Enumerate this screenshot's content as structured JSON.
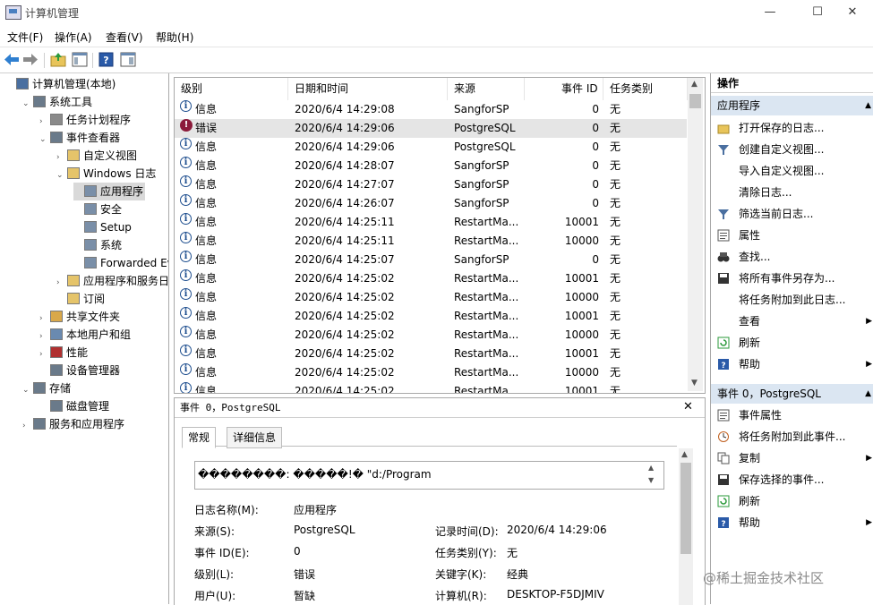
{
  "window": {
    "title": "计算机管理",
    "minimize": "—",
    "maximize": "☐",
    "close": "✕"
  },
  "menu": [
    "文件(F)",
    "操作(A)",
    "查看(V)",
    "帮助(H)"
  ],
  "tree": [
    {
      "label": "计算机管理(本地)",
      "indent": 0,
      "exp": "",
      "color": "#4a6fa0"
    },
    {
      "label": "系统工具",
      "indent": 1,
      "exp": "⌄",
      "color": "#6a7a8a"
    },
    {
      "label": "任务计划程序",
      "indent": 2,
      "exp": "›",
      "color": "#8a8a8a"
    },
    {
      "label": "事件查看器",
      "indent": 2,
      "exp": "⌄",
      "color": "#6a7a8a"
    },
    {
      "label": "自定义视图",
      "indent": 3,
      "exp": "›",
      "color": "#e5c46a"
    },
    {
      "label": "Windows 日志",
      "indent": 3,
      "exp": "⌄",
      "color": "#e5c46a"
    },
    {
      "label": "应用程序",
      "indent": 4,
      "exp": "",
      "color": "#7a8fa8",
      "selected": true
    },
    {
      "label": "安全",
      "indent": 4,
      "exp": "",
      "color": "#7a8fa8"
    },
    {
      "label": "Setup",
      "indent": 4,
      "exp": "",
      "color": "#7a8fa8"
    },
    {
      "label": "系统",
      "indent": 4,
      "exp": "",
      "color": "#7a8fa8"
    },
    {
      "label": "Forwarded Eve",
      "indent": 4,
      "exp": "",
      "color": "#7a8fa8"
    },
    {
      "label": "应用程序和服务日志",
      "indent": 3,
      "exp": "›",
      "color": "#e5c46a"
    },
    {
      "label": "订阅",
      "indent": 3,
      "exp": "",
      "color": "#e5c46a"
    },
    {
      "label": "共享文件夹",
      "indent": 2,
      "exp": "›",
      "color": "#d9a84a"
    },
    {
      "label": "本地用户和组",
      "indent": 2,
      "exp": "›",
      "color": "#6a8ab0"
    },
    {
      "label": "性能",
      "indent": 2,
      "exp": "›",
      "color": "#b03030"
    },
    {
      "label": "设备管理器",
      "indent": 2,
      "exp": "",
      "color": "#6a7a8a"
    },
    {
      "label": "存储",
      "indent": 1,
      "exp": "⌄",
      "color": "#6a7a8a"
    },
    {
      "label": "磁盘管理",
      "indent": 2,
      "exp": "",
      "color": "#6a7a8a"
    },
    {
      "label": "服务和应用程序",
      "indent": 1,
      "exp": "›",
      "color": "#6a7a8a"
    }
  ],
  "table": {
    "headers": [
      "级别",
      "日期和时间",
      "来源",
      "事件 ID",
      "任务类别"
    ],
    "rows": [
      {
        "level": "信息",
        "type": "info",
        "date": "2020/6/4 14:29:08",
        "source": "SangforSP",
        "id": "0",
        "cat": "无"
      },
      {
        "level": "错误",
        "type": "error",
        "date": "2020/6/4 14:29:06",
        "source": "PostgreSQL",
        "id": "0",
        "cat": "无"
      },
      {
        "level": "信息",
        "type": "info",
        "date": "2020/6/4 14:29:06",
        "source": "PostgreSQL",
        "id": "0",
        "cat": "无"
      },
      {
        "level": "信息",
        "type": "info",
        "date": "2020/6/4 14:28:07",
        "source": "SangforSP",
        "id": "0",
        "cat": "无"
      },
      {
        "level": "信息",
        "type": "info",
        "date": "2020/6/4 14:27:07",
        "source": "SangforSP",
        "id": "0",
        "cat": "无"
      },
      {
        "level": "信息",
        "type": "info",
        "date": "2020/6/4 14:26:07",
        "source": "SangforSP",
        "id": "0",
        "cat": "无"
      },
      {
        "level": "信息",
        "type": "info",
        "date": "2020/6/4 14:25:11",
        "source": "RestartMa...",
        "id": "10001",
        "cat": "无"
      },
      {
        "level": "信息",
        "type": "info",
        "date": "2020/6/4 14:25:11",
        "source": "RestartMa...",
        "id": "10000",
        "cat": "无"
      },
      {
        "level": "信息",
        "type": "info",
        "date": "2020/6/4 14:25:07",
        "source": "SangforSP",
        "id": "0",
        "cat": "无"
      },
      {
        "level": "信息",
        "type": "info",
        "date": "2020/6/4 14:25:02",
        "source": "RestartMa...",
        "id": "10001",
        "cat": "无"
      },
      {
        "level": "信息",
        "type": "info",
        "date": "2020/6/4 14:25:02",
        "source": "RestartMa...",
        "id": "10000",
        "cat": "无"
      },
      {
        "level": "信息",
        "type": "info",
        "date": "2020/6/4 14:25:02",
        "source": "RestartMa...",
        "id": "10001",
        "cat": "无"
      },
      {
        "level": "信息",
        "type": "info",
        "date": "2020/6/4 14:25:02",
        "source": "RestartMa...",
        "id": "10000",
        "cat": "无"
      },
      {
        "level": "信息",
        "type": "info",
        "date": "2020/6/4 14:25:02",
        "source": "RestartMa...",
        "id": "10001",
        "cat": "无"
      },
      {
        "level": "信息",
        "type": "info",
        "date": "2020/6/4 14:25:02",
        "source": "RestartMa...",
        "id": "10000",
        "cat": "无"
      },
      {
        "level": "信息",
        "type": "info",
        "date": "2020/6/4 14:25:02",
        "source": "RestartMa...",
        "id": "10001",
        "cat": "无"
      }
    ]
  },
  "detail": {
    "header": "事件 0，PostgreSQL",
    "close": "✕",
    "tabs": [
      "常规",
      "详细信息"
    ],
    "message": "��������: �����!� \"d:/Program",
    "fields": {
      "log_name_label": "日志名称(M):",
      "log_name": "应用程序",
      "source_label": "来源(S):",
      "source": "PostgreSQL",
      "logged_label": "记录时间(D):",
      "logged": "2020/6/4 14:29:06",
      "event_id_label": "事件 ID(E):",
      "event_id": "0",
      "task_label": "任务类别(Y):",
      "task": "无",
      "level_label": "级别(L):",
      "level": "错误",
      "keywords_label": "关键字(K):",
      "keywords": "经典",
      "user_label": "用户(U):",
      "user": "暂缺",
      "computer_label": "计算机(R):",
      "computer": "DESKTOP-F5DJMIV"
    }
  },
  "actions": {
    "title": "操作",
    "section1": "应用程序",
    "items1": [
      {
        "label": "打开保存的日志...",
        "icon": "folder-open-icon",
        "arrow": false
      },
      {
        "label": "创建自定义视图...",
        "icon": "filter-icon",
        "arrow": false
      },
      {
        "label": "导入自定义视图...",
        "icon": "",
        "arrow": false
      },
      {
        "label": "清除日志...",
        "icon": "",
        "arrow": false
      },
      {
        "label": "筛选当前日志...",
        "icon": "filter-icon",
        "arrow": false
      },
      {
        "label": "属性",
        "icon": "properties-icon",
        "arrow": false
      },
      {
        "label": "查找...",
        "icon": "binoculars-icon",
        "arrow": false
      },
      {
        "label": "将所有事件另存为...",
        "icon": "save-icon",
        "arrow": false
      },
      {
        "label": "将任务附加到此日志...",
        "icon": "",
        "arrow": false
      },
      {
        "label": "查看",
        "icon": "",
        "arrow": true
      },
      {
        "label": "刷新",
        "icon": "refresh-icon",
        "arrow": false
      },
      {
        "label": "帮助",
        "icon": "help-icon",
        "arrow": true
      }
    ],
    "section2": "事件 0，PostgreSQL",
    "items2": [
      {
        "label": "事件属性",
        "icon": "properties-icon",
        "arrow": false
      },
      {
        "label": "将任务附加到此事件...",
        "icon": "task-icon",
        "arrow": false
      },
      {
        "label": "复制",
        "icon": "copy-icon",
        "arrow": true
      },
      {
        "label": "保存选择的事件...",
        "icon": "save-icon",
        "arrow": false
      },
      {
        "label": "刷新",
        "icon": "refresh-icon",
        "arrow": false
      },
      {
        "label": "帮助",
        "icon": "help-icon",
        "arrow": true
      }
    ]
  },
  "watermark": "@稀土掘金技术社区",
  "colors": {
    "accent": "#dbe6f2",
    "selection": "#d9d9d9",
    "error": "#8b1a3a",
    "info": "#1f4f8f"
  }
}
